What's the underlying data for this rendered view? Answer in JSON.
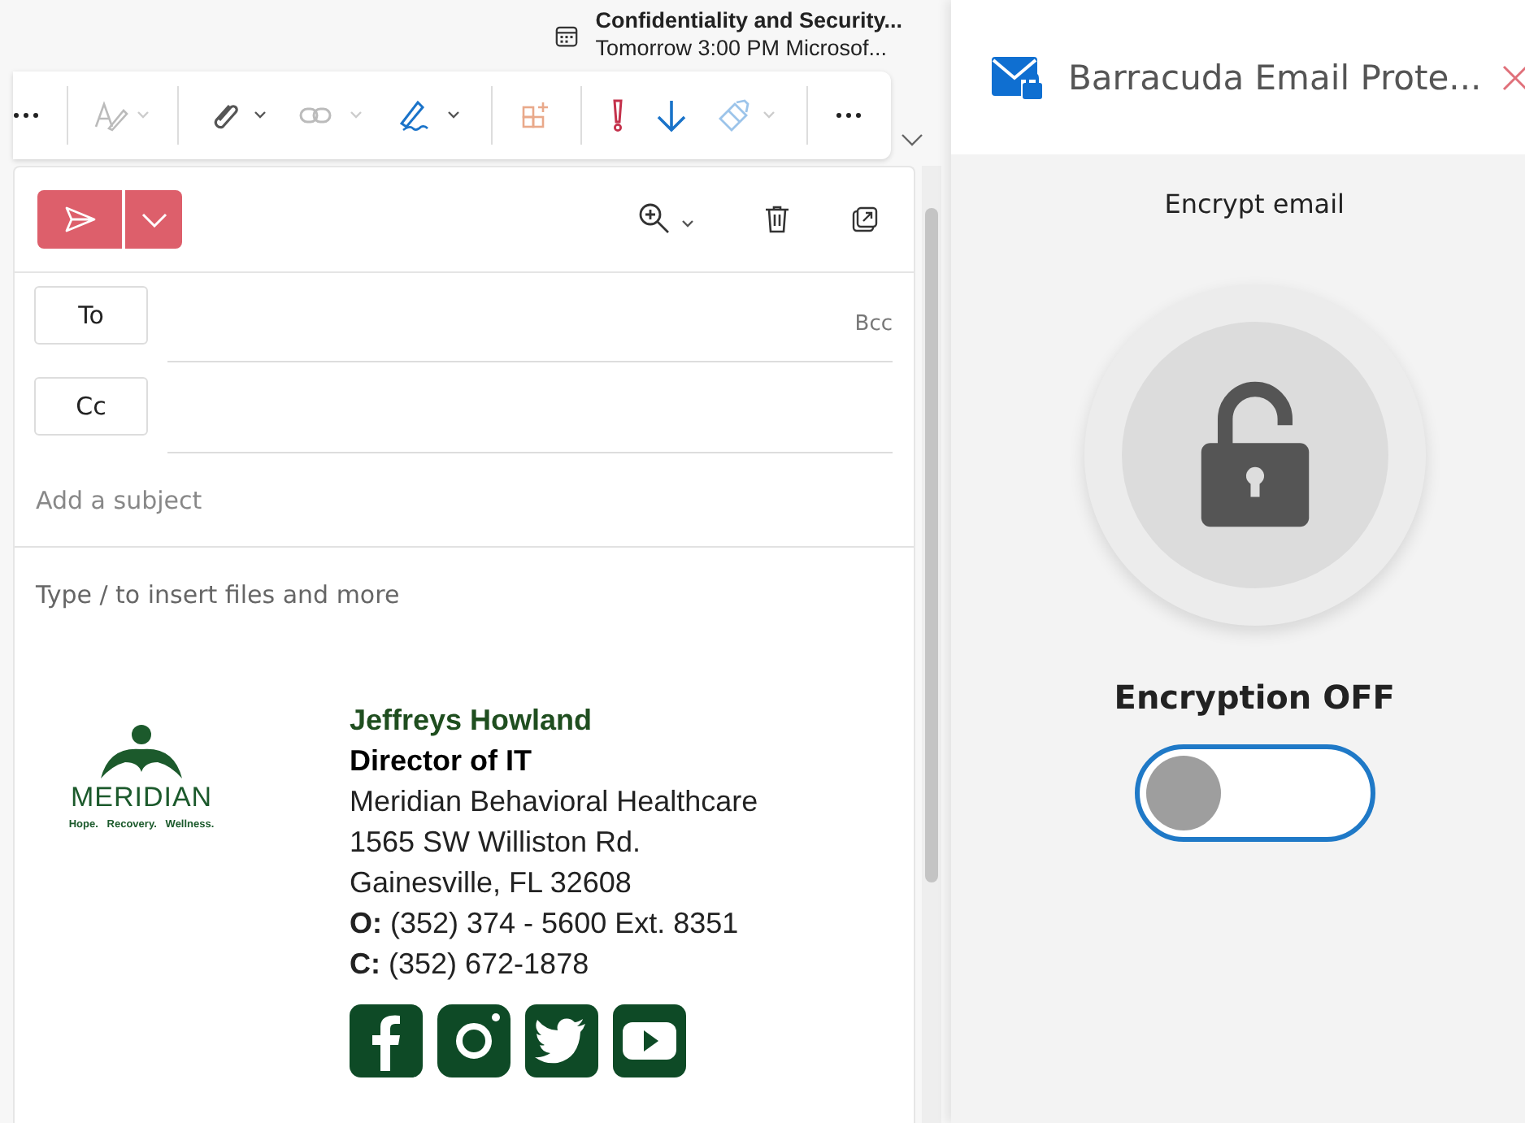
{
  "meeting": {
    "title": "Confidentiality and Security...",
    "subtitle": "Tomorrow 3:00 PM Microsof..."
  },
  "compose": {
    "to_label": "To",
    "cc_label": "Cc",
    "bcc_label": "Bcc",
    "subject_placeholder": "Add a subject",
    "body_placeholder": "Type / to insert files and more"
  },
  "signature": {
    "logo_name": "MERIDIAN",
    "logo_tagline": "Hope.   Recovery.   Wellness.",
    "name": "Jeffreys Howland",
    "title": "Director of IT",
    "lines": [
      "Meridian Behavioral Healthcare",
      "1565 SW Williston Rd.",
      "Gainesville, FL 32608",
      "**O:** (352) 374 - 5600 Ext. 8351",
      "**C:** (352) 672-1878"
    ]
  },
  "addin": {
    "title": "Barracuda Email Prote...",
    "heading": "Encrypt email",
    "status": "Encryption OFF",
    "encryption_on": false
  }
}
